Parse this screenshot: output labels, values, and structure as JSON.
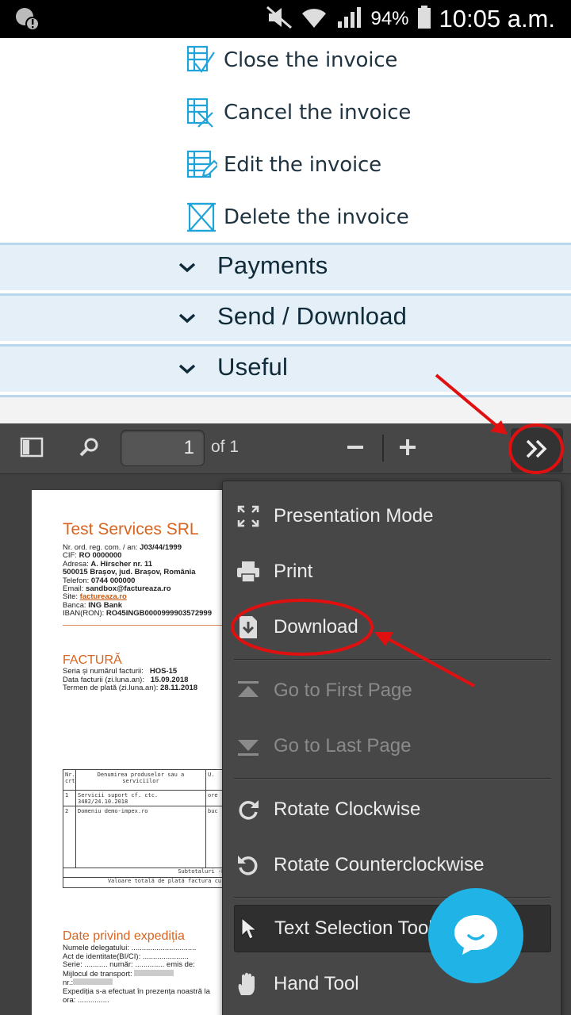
{
  "status_bar": {
    "battery_percent": "94%",
    "time": "10:05 a.m."
  },
  "invoice_actions": [
    {
      "label": "Close the invoice",
      "icon": "invoice-check-icon"
    },
    {
      "label": "Cancel the invoice",
      "icon": "invoice-cancel-icon"
    },
    {
      "label": "Edit the invoice",
      "icon": "invoice-edit-icon"
    },
    {
      "label": "Delete the invoice",
      "icon": "invoice-delete-icon"
    }
  ],
  "accordion": [
    {
      "label": "Payments"
    },
    {
      "label": "Send / Download"
    },
    {
      "label": "Useful"
    }
  ],
  "pdf_toolbar": {
    "page_number": "1",
    "page_count_label": "of 1"
  },
  "pdf_page": {
    "company_name": "Test Services SRL",
    "reg_line_label": "Nr. ord. reg. com. / an: ",
    "reg_line_value": "J03/44/1999",
    "cif_label": "CIF: ",
    "cif_value": "RO 0000000",
    "address_label": "Adresa: ",
    "address_value": "A. Hirscher nr. 11",
    "address_line2": "500015 Brașov, jud. Brașov, România",
    "phone_label": "Telefon: ",
    "phone_value": "0744 000000",
    "email_label": "Email: ",
    "email_value": "sandbox@factureaza.ro",
    "site_label": "Site: ",
    "site_value": "factureaza.ro",
    "bank_label": "Banca: ",
    "bank_value": "ING Bank",
    "iban_label": "IBAN(RON): ",
    "iban_value": "RO45INGB0000999903572999",
    "invoice_title": "FACTURĂ",
    "series_label": "Seria și numărul facturii:",
    "series_value": "HOS-15",
    "date_label": "Data facturii (zi.luna.an):",
    "date_value": "15.09.2018",
    "due_label": "Termen de plată (zi.luna.an):",
    "due_value": "28.11.2018",
    "table_header_nr": "Nr. crt",
    "table_header_desc": "Denumirea produselor sau a serviciilor",
    "table_header_unit": "U.",
    "row1_nr": "1",
    "row1_desc": "Servicii suport cf. ctc. 3482/24.10.2018",
    "row1_unit": "ore",
    "row2_nr": "2",
    "row2_desc": "Domeniu demo-impex.ro",
    "row2_unit": "buc",
    "subtotal_label": "Subtotaluri -RON-",
    "total_label": "Valoare totală de plată factura curent",
    "shipping_title": "Date privind expediția",
    "ship_line1": "Numele delegatului: ...............................",
    "ship_line2": "Act de identitate(BI/CI): ......................",
    "ship_line3": "Serie: ........... număr: .............. emis de:",
    "ship_line4": "Mijlocul de transport: ",
    "ship_line5": "nr.:",
    "ship_line6": "Expediția s-a efectuat în prezența noastră la",
    "ship_line7": "ora: ..............."
  },
  "tools_menu": [
    {
      "label": "Presentation Mode",
      "icon": "presentation-mode-icon",
      "enabled": true
    },
    {
      "label": "Print",
      "icon": "print-icon",
      "enabled": true
    },
    {
      "label": "Download",
      "icon": "download-icon",
      "enabled": true
    },
    {
      "label": "Go to First Page",
      "icon": "first-page-icon",
      "enabled": false
    },
    {
      "label": "Go to Last Page",
      "icon": "last-page-icon",
      "enabled": false
    },
    {
      "label": "Rotate Clockwise",
      "icon": "rotate-clockwise-icon",
      "enabled": true
    },
    {
      "label": "Rotate Counterclockwise",
      "icon": "rotate-counterclockwise-icon",
      "enabled": true
    },
    {
      "label": "Text Selection Tool",
      "icon": "cursor-icon",
      "enabled": true,
      "toggled": true
    },
    {
      "label": "Hand Tool",
      "icon": "hand-icon",
      "enabled": true
    }
  ],
  "colors": {
    "action_icon": "#1fa3d8",
    "accordion_bg": "#e4eff7",
    "viewer_bg": "#404040",
    "annotation_red": "#e01010",
    "chat_bubble": "#1fb3e6",
    "brand_orange": "#d8641f"
  }
}
